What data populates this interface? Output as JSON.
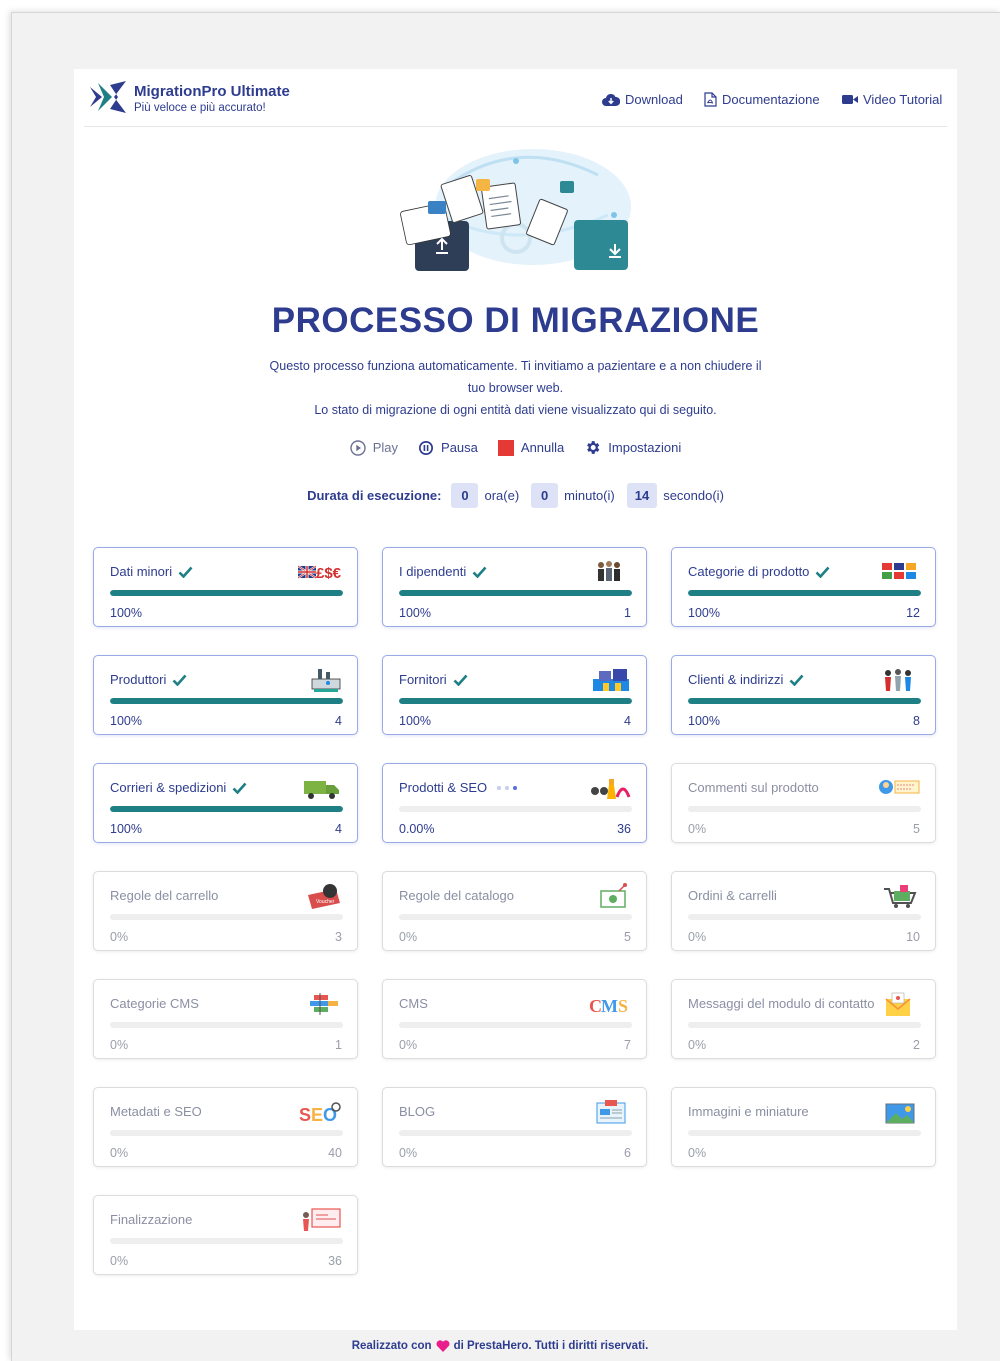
{
  "brand": {
    "name": "MigrationPro Ultimate",
    "tagline": "Più veloce e più accurato!"
  },
  "nav": [
    {
      "label": "Download",
      "icon": "cloud-download-icon"
    },
    {
      "label": "Documentazione",
      "icon": "pdf-file-icon"
    },
    {
      "label": "Video Tutorial",
      "icon": "video-camera-icon"
    }
  ],
  "hero": {
    "icon": "folders-migration-illustration"
  },
  "title": "PROCESSO DI MIGRAZIONE",
  "description": {
    "line1": "Questo processo funziona automaticamente. Ti invitiamo a pazientare e a non chiudere il",
    "line2": "tuo browser web.",
    "line3": "Lo stato di migrazione di ogni entità dati viene visualizzato qui di seguito."
  },
  "controls": {
    "play": "Play",
    "pause": "Pausa",
    "cancel": "Annulla",
    "settings": "Impostazioni"
  },
  "duration": {
    "label": "Durata di esecuzione:",
    "hours": "0",
    "hours_unit": "ora(e)",
    "minutes": "0",
    "minutes_unit": "minuto(i)",
    "seconds": "14",
    "seconds_unit": "secondo(i)"
  },
  "colors": {
    "primary": "#2e3c8f",
    "progress": "#1e7f85",
    "cancel": "#e53935",
    "active_border": "#9aa9e8"
  },
  "entities": [
    {
      "name": "Dati minori",
      "percent": "100%",
      "progress": 1.0,
      "count": "",
      "done": true,
      "icon": "currency-flag-icon"
    },
    {
      "name": "I dipendenti",
      "percent": "100%",
      "progress": 1.0,
      "count": "1",
      "done": true,
      "icon": "employees-icon"
    },
    {
      "name": "Categorie di prodotto",
      "percent": "100%",
      "progress": 1.0,
      "count": "12",
      "done": true,
      "icon": "categories-grid-icon"
    },
    {
      "name": "Produttori",
      "percent": "100%",
      "progress": 1.0,
      "count": "4",
      "done": true,
      "icon": "factory-icon"
    },
    {
      "name": "Fornitori",
      "percent": "100%",
      "progress": 1.0,
      "count": "4",
      "done": true,
      "icon": "warehouse-icon"
    },
    {
      "name": "Clienti & indirizzi",
      "percent": "100%",
      "progress": 1.0,
      "count": "8",
      "done": true,
      "icon": "customers-icon"
    },
    {
      "name": "Corrieri & spedizioni",
      "percent": "100%",
      "progress": 1.0,
      "count": "4",
      "done": true,
      "icon": "truck-icon"
    },
    {
      "name": "Prodotti & SEO",
      "percent": "0.00%",
      "progress": 0.0,
      "count": "36",
      "done": false,
      "loading": true,
      "icon": "products-icon"
    },
    {
      "name": "Commenti sul prodotto",
      "percent": "0%",
      "progress": 0.0,
      "count": "5",
      "done": false,
      "icon": "comment-icon"
    },
    {
      "name": "Regole del carrello",
      "percent": "0%",
      "progress": 0.0,
      "count": "3",
      "done": false,
      "icon": "voucher-icon"
    },
    {
      "name": "Regole del catalogo",
      "percent": "0%",
      "progress": 0.0,
      "count": "5",
      "done": false,
      "icon": "price-tag-icon"
    },
    {
      "name": "Ordini & carrelli",
      "percent": "0%",
      "progress": 0.0,
      "count": "10",
      "done": false,
      "icon": "cart-icon"
    },
    {
      "name": "Categorie CMS",
      "percent": "0%",
      "progress": 0.0,
      "count": "1",
      "done": false,
      "icon": "cms-categories-icon"
    },
    {
      "name": "CMS",
      "percent": "0%",
      "progress": 0.0,
      "count": "7",
      "done": false,
      "icon": "cms-icon",
      "icon_text": "CMS"
    },
    {
      "name": "Messaggi del modulo di contatto",
      "percent": "0%",
      "progress": 0.0,
      "count": "2",
      "done": false,
      "icon": "envelope-icon"
    },
    {
      "name": "Metadati e SEO",
      "percent": "0%",
      "progress": 0.0,
      "count": "40",
      "done": false,
      "icon": "seo-icon",
      "icon_text": "SEO"
    },
    {
      "name": "BLOG",
      "percent": "0%",
      "progress": 0.0,
      "count": "6",
      "done": false,
      "icon": "blog-icon"
    },
    {
      "name": "Immagini e miniature",
      "percent": "0%",
      "progress": 0.0,
      "count": "",
      "done": false,
      "icon": "image-icon"
    },
    {
      "name": "Finalizzazione",
      "percent": "0%",
      "progress": 0.0,
      "count": "36",
      "done": false,
      "icon": "presentation-icon"
    }
  ],
  "footer": {
    "prefix": "Realizzato con",
    "suffix": "di PrestaHero. Tutti i diritti riservati."
  }
}
